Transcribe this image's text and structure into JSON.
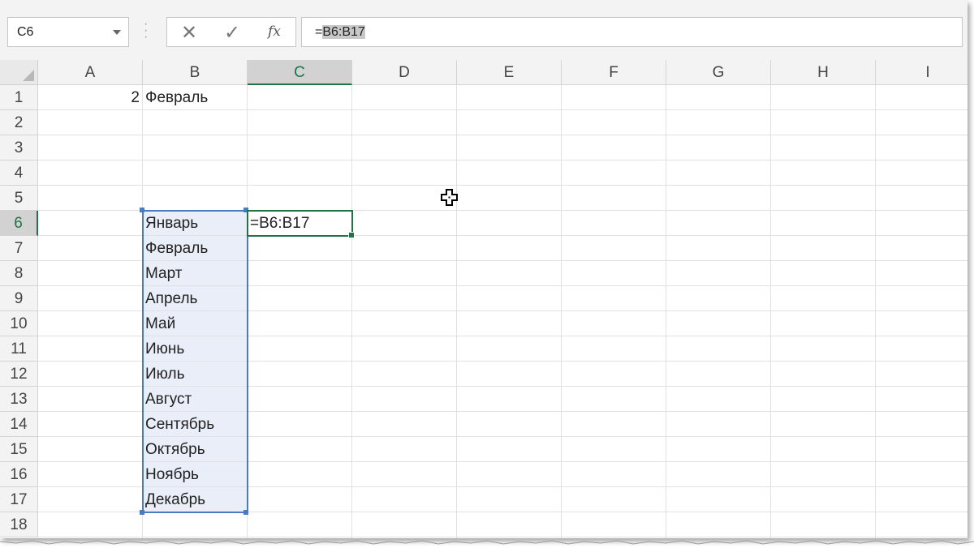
{
  "formula_bar": {
    "name_box": "C6",
    "cancel_glyph": "✕",
    "enter_glyph": "✓",
    "fx_label": "fx",
    "formula_prefix": "=",
    "formula_highlight": "B6:B17"
  },
  "columns": [
    "A",
    "B",
    "C",
    "D",
    "E",
    "F",
    "G",
    "H",
    "I"
  ],
  "active_column": "C",
  "rows": [
    "1",
    "2",
    "3",
    "4",
    "5",
    "6",
    "7",
    "8",
    "9",
    "10",
    "11",
    "12",
    "13",
    "14",
    "15",
    "16",
    "17",
    "18"
  ],
  "active_row": "6",
  "cells": {
    "A1": "2",
    "B1": "Февраль",
    "C6": "=B6:B17",
    "months": [
      "Январь",
      "Февраль",
      "Март",
      "Апрель",
      "Май",
      "Июнь",
      "Июль",
      "Август",
      "Сентябрь",
      "Октябрь",
      "Ноябрь",
      "Декабрь"
    ]
  },
  "colors": {
    "accent_green": "#217346",
    "range_blue": "#4a7ac0",
    "range_fill": "#e9eef8"
  },
  "icons": {
    "cursor": "cross-cursor-icon",
    "cancel": "close-icon",
    "enter": "check-icon",
    "function": "fx-icon"
  }
}
